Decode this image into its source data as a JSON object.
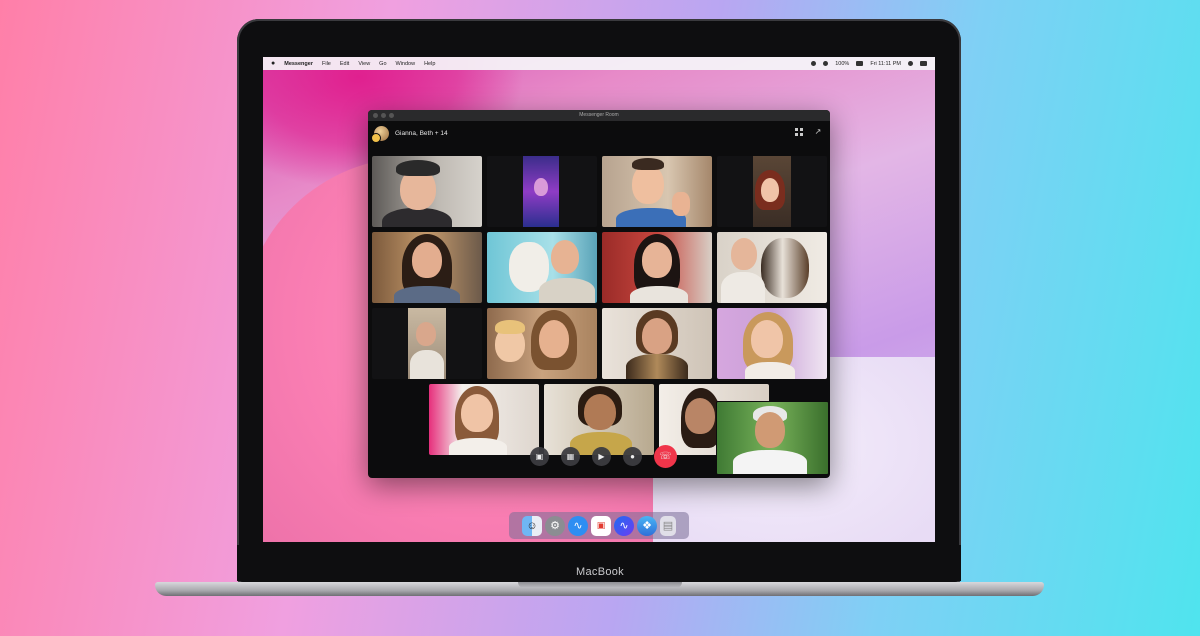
{
  "menubar": {
    "app_name": "Messenger",
    "items": [
      "File",
      "Edit",
      "View",
      "Go",
      "Window",
      "Help"
    ],
    "battery": "100%",
    "clock": "Fri 11:11 PM"
  },
  "window": {
    "title": "Messenger Room",
    "room_title": "Gianna, Beth + 14"
  },
  "brand": {
    "label": "MacBook"
  },
  "colors": {
    "end_call": "#f0354a",
    "window_bg": "#0c0c0d",
    "accent_pink": "#e0208f"
  },
  "icons": {
    "header": [
      "grid-icon",
      "expand-icon"
    ],
    "controls": [
      "share-screen-icon",
      "group-icon",
      "camera-icon",
      "microphone-icon",
      "end-call-icon"
    ],
    "dock": [
      "finder-icon",
      "settings-icon",
      "messenger-blue-icon",
      "calendar-icon",
      "messenger-icon",
      "safari-icon",
      "trash-icon"
    ]
  }
}
